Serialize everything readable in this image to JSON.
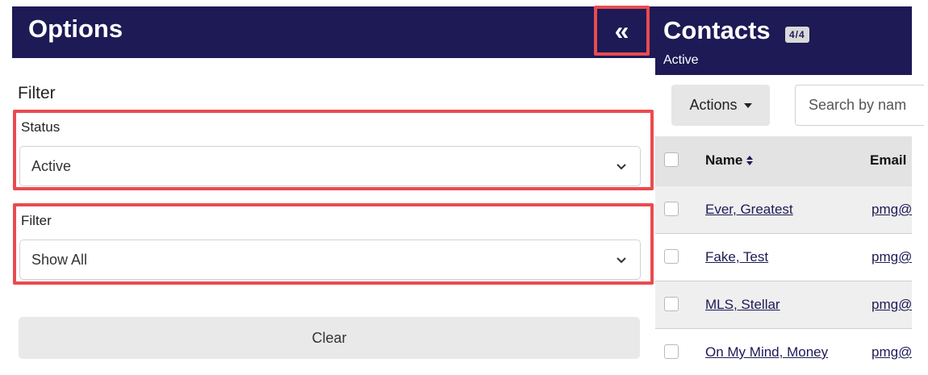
{
  "options": {
    "title": "Options",
    "collapse_glyph": "«",
    "filter_heading": "Filter",
    "status": {
      "label": "Status",
      "value": "Active"
    },
    "filter": {
      "label": "Filter",
      "value": "Show All"
    },
    "clear_label": "Clear"
  },
  "contacts": {
    "title": "Contacts",
    "count": "4/4",
    "subtitle": "Active",
    "actions_label": "Actions",
    "search_placeholder": "Search by nam",
    "columns": {
      "name": "Name",
      "email": "Email"
    },
    "rows": [
      {
        "name": "Ever, Greatest",
        "email": "pmg@"
      },
      {
        "name": "Fake, Test",
        "email": "pmg@"
      },
      {
        "name": "MLS, Stellar",
        "email": "pmg@"
      },
      {
        "name": "On My Mind, Money",
        "email": "pmg@"
      }
    ]
  },
  "colors": {
    "header_bg": "#1d1a56",
    "highlight": "#e94b50",
    "link": "#1d1a56"
  },
  "icons": [
    "double-chevron-left-icon",
    "chevron-down-icon",
    "caret-down-icon",
    "sort-icon"
  ]
}
